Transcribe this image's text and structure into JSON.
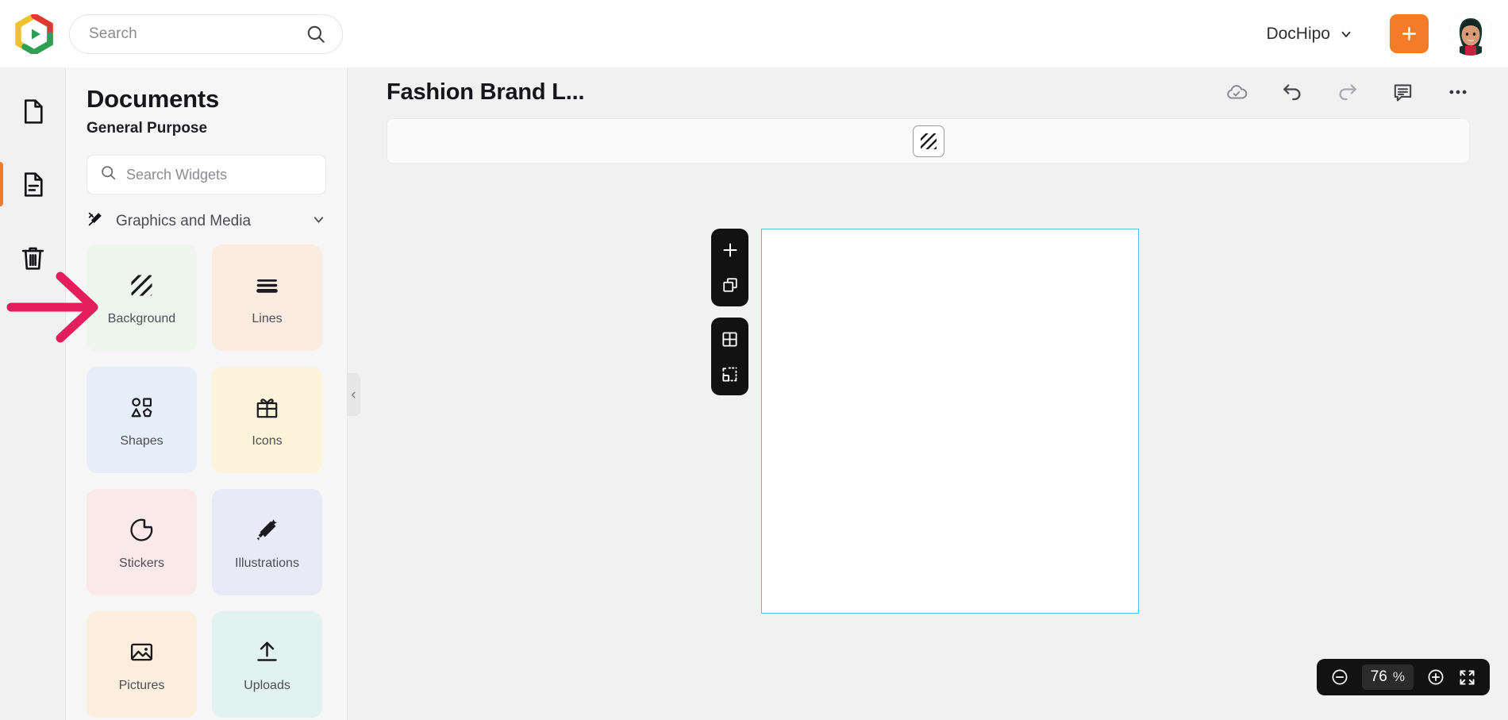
{
  "app": {
    "brand_color": "#F47B28",
    "accent_blue": "#61BDE8",
    "annotation_color": "#E41E5C"
  },
  "topbar": {
    "logo_name": "dochipo-logo",
    "search": {
      "placeholder": "Search",
      "value": "Search",
      "icon": "search-icon"
    },
    "workspace": {
      "label": "DocHipo",
      "chevron_icon": "chevron-down-icon"
    },
    "create_button": {
      "label": "+",
      "icon": "plus-icon"
    },
    "avatar": {
      "alt": "user-avatar"
    }
  },
  "rail": {
    "items": [
      {
        "name": "sidebar-item-documents",
        "icon": "document-icon",
        "active": false
      },
      {
        "name": "sidebar-item-my-documents",
        "icon": "document-lines-icon",
        "active": true
      },
      {
        "name": "sidebar-item-trash",
        "icon": "trash-icon",
        "active": false
      }
    ]
  },
  "panel": {
    "title": "Documents",
    "subtitle": "General Purpose",
    "search": {
      "placeholder": "Search Widgets",
      "value": "Search Widgets",
      "icon": "search-icon"
    },
    "category": {
      "label": "Graphics and Media",
      "icon": "brush-pen-icon",
      "chevron_icon": "chevron-down-icon",
      "expanded": true
    },
    "tiles": [
      {
        "label": "Background",
        "icon": "diagonal-stripes-icon",
        "bg": "#EDF5EC",
        "selected": true
      },
      {
        "label": "Lines",
        "icon": "lines-icon",
        "bg": "#FBEBE1",
        "selected": false
      },
      {
        "label": "Shapes",
        "icon": "shapes-icon",
        "bg": "#E6EFF9",
        "selected": false
      },
      {
        "label": "Icons",
        "icon": "gift-icon",
        "bg": "#FDF3DA",
        "selected": false
      },
      {
        "label": "Stickers",
        "icon": "sticker-icon",
        "bg": "#FBE9E9",
        "selected": false
      },
      {
        "label": "Illustrations",
        "icon": "pen-sparkle-icon",
        "bg": "#EAE9F7",
        "selected": false
      },
      {
        "label": "Pictures",
        "icon": "image-icon",
        "bg": "#FBEEDC",
        "selected": false
      },
      {
        "label": "Uploads",
        "icon": "upload-icon",
        "bg": "#E2F2EE",
        "selected": false
      }
    ],
    "collapse_handle_icon": "chevron-left-icon"
  },
  "editor": {
    "document_title": "Fashion Brand L...",
    "actions": [
      {
        "name": "cloud-saved-icon",
        "tooltip": "Saved"
      },
      {
        "name": "undo-icon",
        "tooltip": "Undo"
      },
      {
        "name": "redo-icon",
        "tooltip": "Redo"
      },
      {
        "name": "comment-icon",
        "tooltip": "Comments"
      },
      {
        "name": "more-options-icon",
        "tooltip": "More"
      }
    ],
    "property_bar": {
      "background_button_icon": "diagonal-stripes-icon"
    },
    "page_tools": [
      [
        {
          "name": "add-page-button",
          "icon": "plus-icon"
        },
        {
          "name": "duplicate-page-button",
          "icon": "duplicate-icon"
        }
      ],
      [
        {
          "name": "grid-view-button",
          "icon": "grid-icon"
        },
        {
          "name": "resize-page-button",
          "icon": "resize-selection-icon"
        }
      ]
    ],
    "canvas": {
      "empty": true,
      "border_color": "#61BDE8"
    },
    "zoom": {
      "minus_icon": "zoom-out-icon",
      "value": "76",
      "unit": "%",
      "plus_icon": "zoom-in-icon",
      "fullscreen_icon": "fullscreen-icon"
    }
  },
  "annotation": {
    "arrow": {
      "name": "annotation-arrow",
      "points_to": "Background",
      "color": "#E41E5C"
    }
  }
}
